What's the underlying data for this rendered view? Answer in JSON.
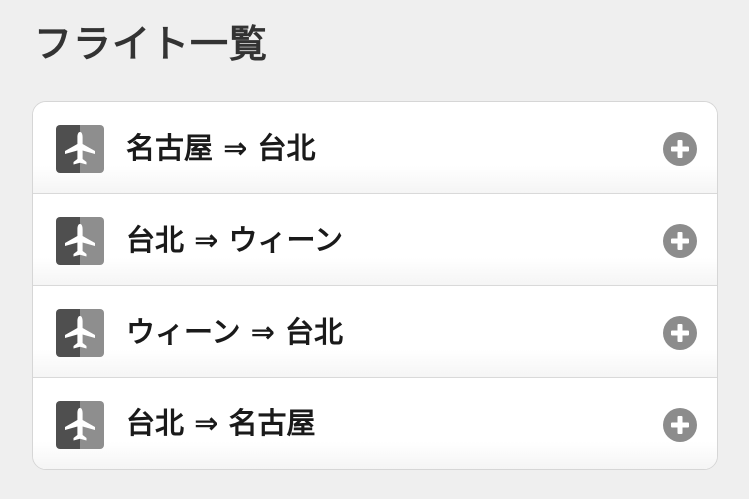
{
  "header": {
    "title": "フライト一覧"
  },
  "flights": [
    {
      "route": "名古屋 ⇒ 台北",
      "icon": "airplane-icon",
      "action_icon": "add-circle-icon"
    },
    {
      "route": "台北 ⇒ ウィーン",
      "icon": "airplane-icon",
      "action_icon": "add-circle-icon"
    },
    {
      "route": "ウィーン ⇒ 台北",
      "icon": "airplane-icon",
      "action_icon": "add-circle-icon"
    },
    {
      "route": "台北 ⇒ 名古屋",
      "icon": "airplane-icon",
      "action_icon": "add-circle-icon"
    }
  ],
  "colors": {
    "background": "#efefef",
    "card": "#ffffff",
    "icon_dark": "#4f4f4f",
    "icon_light": "#8e8e8e",
    "add_button": "#8c8c8c",
    "text": "#1a1a1a"
  }
}
